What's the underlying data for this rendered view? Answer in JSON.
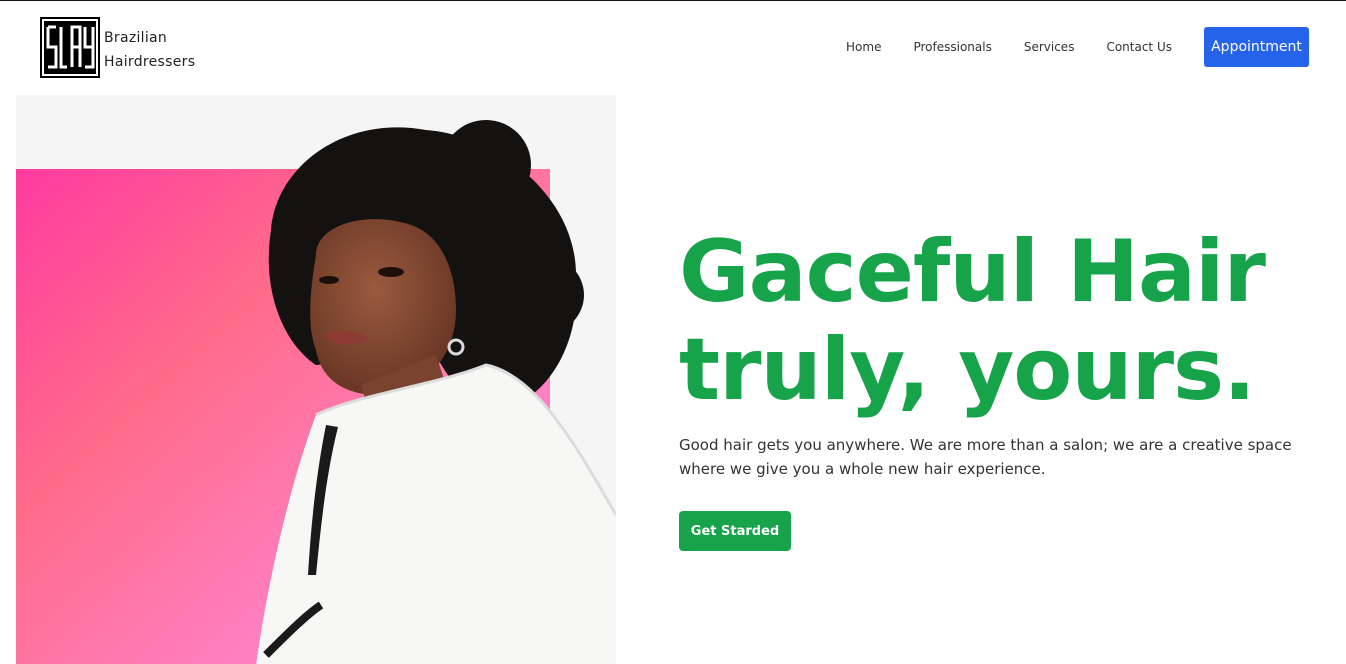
{
  "brand": {
    "logo_icon": "slay-logo-icon",
    "name_line1": "Brazilian",
    "name_line2": "Hairdressers"
  },
  "nav": {
    "items": [
      {
        "label": "Home"
      },
      {
        "label": "Professionals"
      },
      {
        "label": "Services"
      },
      {
        "label": "Contact Us"
      }
    ],
    "cta_label": "Appointment"
  },
  "hero": {
    "headline_line1": "Gaceful Hair",
    "headline_line2": "truly, yours.",
    "description": "Good hair gets you anywhere. We are more than a salon; we are a creative space where we give you a whole new hair experience.",
    "button_label": "Get Starded",
    "image": "woman-curly-hair-white-jacket-photo"
  },
  "colors": {
    "accent_green": "#16a34a",
    "primary_blue": "#2563eb",
    "hero_pink": "#ff4fa3"
  }
}
